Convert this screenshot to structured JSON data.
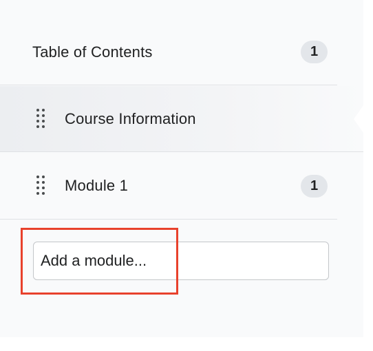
{
  "toc": {
    "title": "Table of Contents",
    "count": "1"
  },
  "modules": [
    {
      "label": "Course Information",
      "count": "",
      "selected": true
    },
    {
      "label": "Module 1",
      "count": "1",
      "selected": false
    }
  ],
  "add_module": {
    "placeholder": "Add a module..."
  },
  "colors": {
    "highlight": "#e8412c",
    "badge_bg": "#e3e6ea",
    "panel_bg": "#f9fafb"
  }
}
